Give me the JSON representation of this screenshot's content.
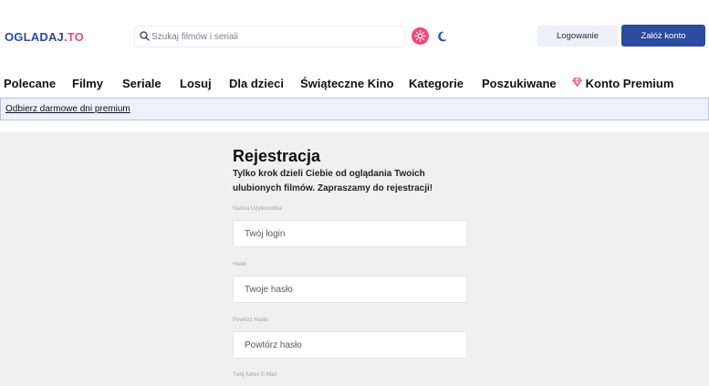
{
  "header": {
    "logo_part1": "OGLADAJ",
    "logo_part2": ".TO",
    "search_placeholder": "Szukaj filmów i seriali",
    "login_label": "Logowanie",
    "register_label": "Załóż konto"
  },
  "nav": {
    "items": [
      "Polecane",
      "Filmy",
      "Seriale",
      "Losuj",
      "Dla dzieci",
      "Świąteczne Kino",
      "Kategorie",
      "Poszukiwane",
      "Konto Premium"
    ]
  },
  "banner": {
    "link_text": "Odbierz darmowe dni premium"
  },
  "registration": {
    "title": "Rejestracja",
    "subtitle": "Tylko krok dzieli Ciebie od oglądania Twoich ulubionych filmów. Zapraszamy do rejestracji!",
    "fields": [
      {
        "label": "Nazwa Użytkownika",
        "placeholder": "Twój login"
      },
      {
        "label": "Hasło",
        "placeholder": "Twoje hasło"
      },
      {
        "label": "Powtórz Hasło",
        "placeholder": "Powtórz hasło"
      },
      {
        "label": "Twój Adres E-Mail",
        "placeholder": ""
      }
    ]
  },
  "colors": {
    "brand_blue": "#2c4b9b",
    "brand_pink": "#e94b7a",
    "register_button": "#2b4aa0"
  },
  "icons": [
    "search-icon",
    "sun-icon",
    "moon-icon",
    "diamond-icon"
  ]
}
